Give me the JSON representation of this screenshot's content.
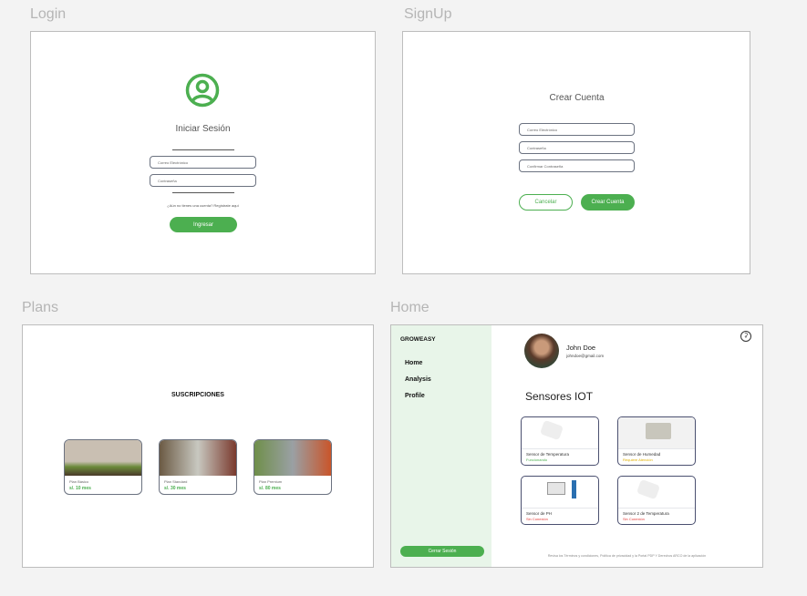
{
  "frames": {
    "login": "Login",
    "signup": "SignUp",
    "plans": "Plans",
    "home": "Home"
  },
  "login": {
    "title": "Iniciar Sesión",
    "email_placeholder": "Correo Electrónico",
    "password_placeholder": "Contraseña",
    "register_link": "¿Aún no tienes una cuenta? Regístrate aquí",
    "submit": "Ingresar"
  },
  "signup": {
    "title": "Crear Cuenta",
    "email_placeholder": "Correo Electrónico",
    "password_placeholder": "Contraseña",
    "confirm_placeholder": "Confirmar Contraseña",
    "cancel": "Cancelar",
    "submit": "Crear Cuenta"
  },
  "plans": {
    "title": "SUSCRIPCIONES",
    "items": [
      {
        "name": "Plan Básico",
        "price": "s/. 10 mes"
      },
      {
        "name": "Plan Standard",
        "price": "s/. 30 mes"
      },
      {
        "name": "Plan Premium",
        "price": "s/. 80 mes"
      }
    ]
  },
  "home": {
    "brand": "GROWEASY",
    "nav": [
      "Home",
      "Analysis",
      "Profile"
    ],
    "logout": "Cerrar Sesión",
    "user_name": "John Doe",
    "user_email": "johndoe@gmail.com",
    "section_title": "Sensores IOT",
    "sensors": [
      {
        "name": "Sensor de Temperatura",
        "status": "Funcionando",
        "color": "#4caf50"
      },
      {
        "name": "Sensor de Humedad",
        "status": "Requiere Atención",
        "color": "#e0b000"
      },
      {
        "name": "Sensor de PH",
        "status": "Sin Conexión",
        "color": "#e53935"
      },
      {
        "name": "Sensor 2 de Temperatura",
        "status": "Sin Conexión",
        "color": "#e53935"
      }
    ],
    "footer": "Revisa los Términos y condiciones, Política de privacidad y la Portal PDP Y Derechos ARCO de la aplicación"
  }
}
